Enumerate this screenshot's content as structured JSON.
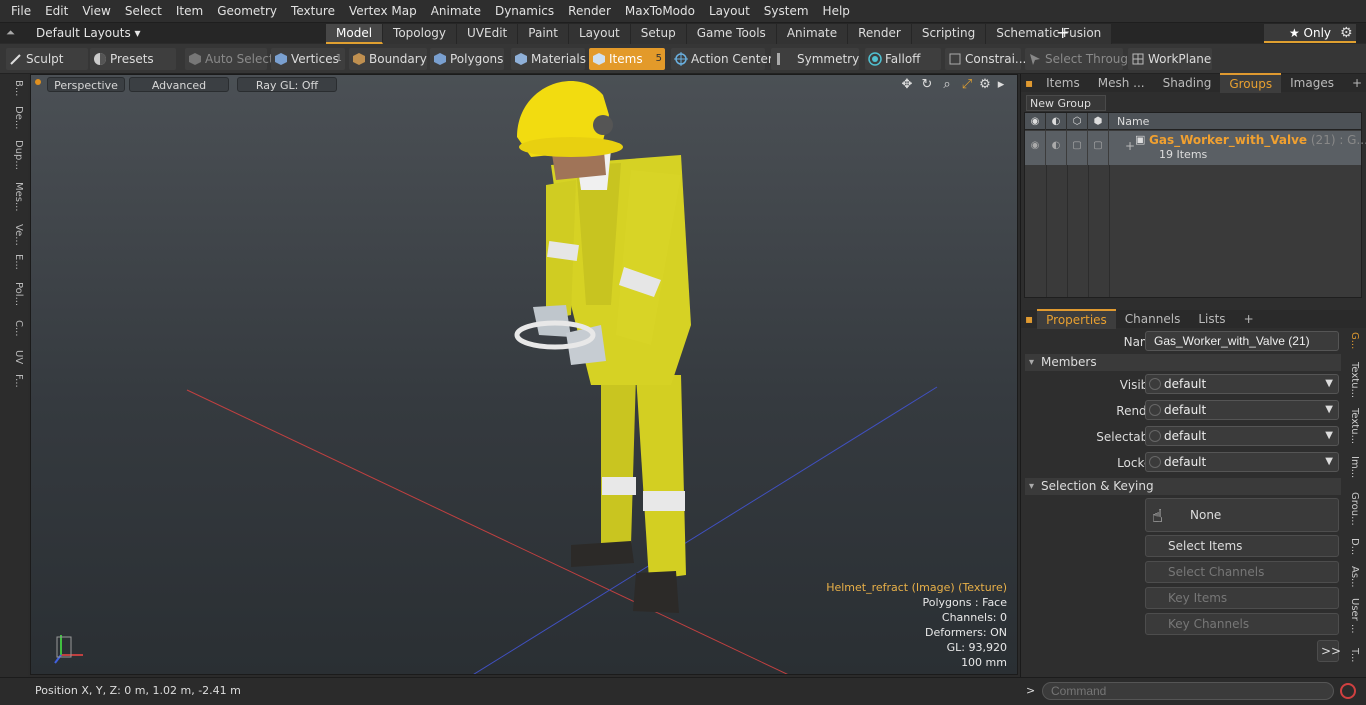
{
  "menu": [
    "File",
    "Edit",
    "View",
    "Select",
    "Item",
    "Geometry",
    "Texture",
    "Vertex Map",
    "Animate",
    "Dynamics",
    "Render",
    "MaxToModo",
    "Layout",
    "System",
    "Help"
  ],
  "layout": {
    "current": "Default Layouts ▾"
  },
  "tabs": [
    "Model",
    "Topology",
    "UVEdit",
    "Paint",
    "Layout",
    "Setup",
    "Game Tools",
    "Animate",
    "Render",
    "Scripting",
    "Schematic Fusion"
  ],
  "active_tab": "Model",
  "only_label": "★  Only",
  "toolbar": {
    "sculpt": "Sculpt",
    "presets": "Presets",
    "auto_select": "Auto Select",
    "vertices": "Vertices",
    "vertices_count": "1",
    "boundary": "Boundary",
    "polygons": "Polygons",
    "materials": "Materials",
    "items": "Items",
    "items_count": "5",
    "action_center": "Action Center",
    "symmetry": "Symmetry",
    "falloff": "Falloff",
    "constraints": "Constrai...",
    "select_through": "Select Through",
    "workplane": "WorkPlane"
  },
  "left_strip": [
    "B...",
    "De...",
    "Dup...",
    "Mes...",
    "Ve...",
    "E...",
    "Pol...",
    "C...",
    "UV",
    "F..."
  ],
  "viewport": {
    "perspective": "Perspective",
    "advanced": "Advanced",
    "raygl": "Ray GL: Off",
    "info": {
      "texture": "Helmet_refract (Image) (Texture)",
      "polygons": "Polygons : Face",
      "channels": "Channels: 0",
      "deformers": "Deformers: ON",
      "gl": "GL: 93,920",
      "scale": "100 mm"
    }
  },
  "status": {
    "position": "Position X, Y, Z:   0 m, 1.02 m, -2.41 m"
  },
  "groups_panel": {
    "tabs": [
      "Items",
      "Mesh ...",
      "Shading",
      "Groups",
      "Images"
    ],
    "active": "Groups",
    "new_group": "New Group",
    "col_name": "Name",
    "group_name": "Gas_Worker_with_Valve",
    "group_dim": " (21) : G...",
    "group_count": "19 Items"
  },
  "props_panel": {
    "tabs": [
      "Properties",
      "Channels",
      "Lists"
    ],
    "active": "Properties",
    "name_label": "Name",
    "name_value": "Gas_Worker_with_Valve (21)",
    "members": "Members",
    "visible_label": "Visible",
    "visible_value": "default",
    "render_label": "Render",
    "render_value": "default",
    "selectable_label": "Selectable",
    "selectable_value": "default",
    "locked_label": "Locked",
    "locked_value": "default",
    "sel_keying": "Selection & Keying",
    "none_btn": "None",
    "select_items": "Select Items",
    "select_channels": "Select Channels",
    "key_items": "Key Items",
    "key_channels": "Key Channels",
    "more": ">>"
  },
  "right_vtabs": [
    "G...",
    "Textu...",
    "Textu...",
    "Im...",
    "Grou...",
    "D...",
    "As...",
    "User ...",
    "T..."
  ],
  "command": {
    "placeholder": "Command"
  },
  "colors": {
    "accent": "#e39a2a",
    "suit": "#d8d424",
    "helmet": "#f2dc10"
  }
}
